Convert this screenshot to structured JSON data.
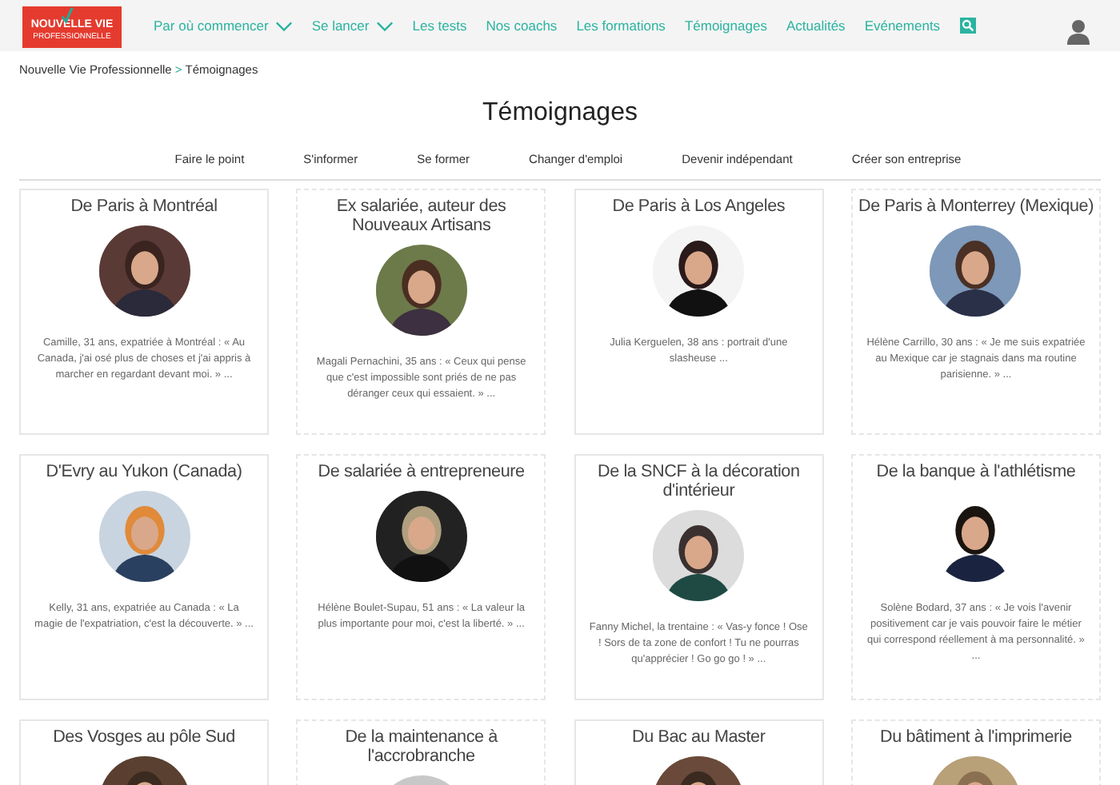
{
  "header": {
    "logo": {
      "line_1": "NOUVELLE VIE",
      "line_2": "PROFESSIONNELLE"
    },
    "nav": [
      {
        "label": "Par où commencer",
        "has_menu": true
      },
      {
        "label": "Se lancer",
        "has_menu": true
      },
      {
        "label": "Les tests",
        "has_menu": false
      },
      {
        "label": "Nos coachs",
        "has_menu": false
      },
      {
        "label": "Les formations",
        "has_menu": false
      },
      {
        "label": "Témoignages",
        "has_menu": false
      },
      {
        "label": "Actualités",
        "has_menu": false
      },
      {
        "label": "Evénements",
        "has_menu": false
      }
    ]
  },
  "breadcrumb": [
    "Nouvelle Vie Professionnelle",
    "Témoignages"
  ],
  "breadcrumb_separator": ">",
  "title": "Témoignages",
  "categories": [
    "Faire le point",
    "S'informer",
    "Se former",
    "Changer d'emploi",
    "Devenir indépendant",
    "Créer son entreprise"
  ],
  "cards": [
    {
      "title": "De Paris à Montréal",
      "excerpt": "Camille, 31 ans, expatriée à Montréal : « Au Canada, j'ai osé plus de choses et j'ai appris à marcher en regardant devant moi. » ..."
    },
    {
      "title": "Ex salariée, auteur des Nouveaux Artisans",
      "excerpt": "Magali Pernachini, 35 ans : « Ceux qui pense que c'est impossible sont priés de ne pas déranger ceux qui essaient. » ..."
    },
    {
      "title": "De Paris à Los Angeles",
      "excerpt": "Julia Kerguelen, 38 ans : portrait d'une slasheuse ..."
    },
    {
      "title": "De Paris à Monterrey (Mexique)",
      "excerpt": "Hélène Carrillo, 30 ans : « Je me suis expatriée au Mexique car je stagnais dans ma routine parisienne. » ..."
    },
    {
      "title": "D'Evry au Yukon (Canada)",
      "excerpt": "Kelly, 31 ans, expatriée au Canada : « La magie de l'expatriation, c'est la découverte. » ..."
    },
    {
      "title": "De salariée à entrepreneure",
      "excerpt": "Hélène Boulet-Supau, 51 ans : « La valeur la plus importante pour moi, c'est la liberté. » ..."
    },
    {
      "title": "De la SNCF à la décoration d'intérieur",
      "excerpt": "Fanny Michel, la trentaine : « Vas-y fonce ! Ose ! Sors de ta zone de confort ! Tu ne pourras qu'apprécier ! Go go go ! » ..."
    },
    {
      "title": "De la banque à l'athlétisme",
      "excerpt": "Solène Bodard, 37 ans : « Je vois l'avenir positivement car je vais pouvoir faire le métier qui correspond réellement à ma personnalité. » ..."
    },
    {
      "title": "Des Vosges au pôle Sud"
    },
    {
      "title": "De la maintenance à l'accrobranche"
    },
    {
      "title": "Du Bac au Master"
    },
    {
      "title": "Du bâtiment à l'imprimerie"
    }
  ]
}
